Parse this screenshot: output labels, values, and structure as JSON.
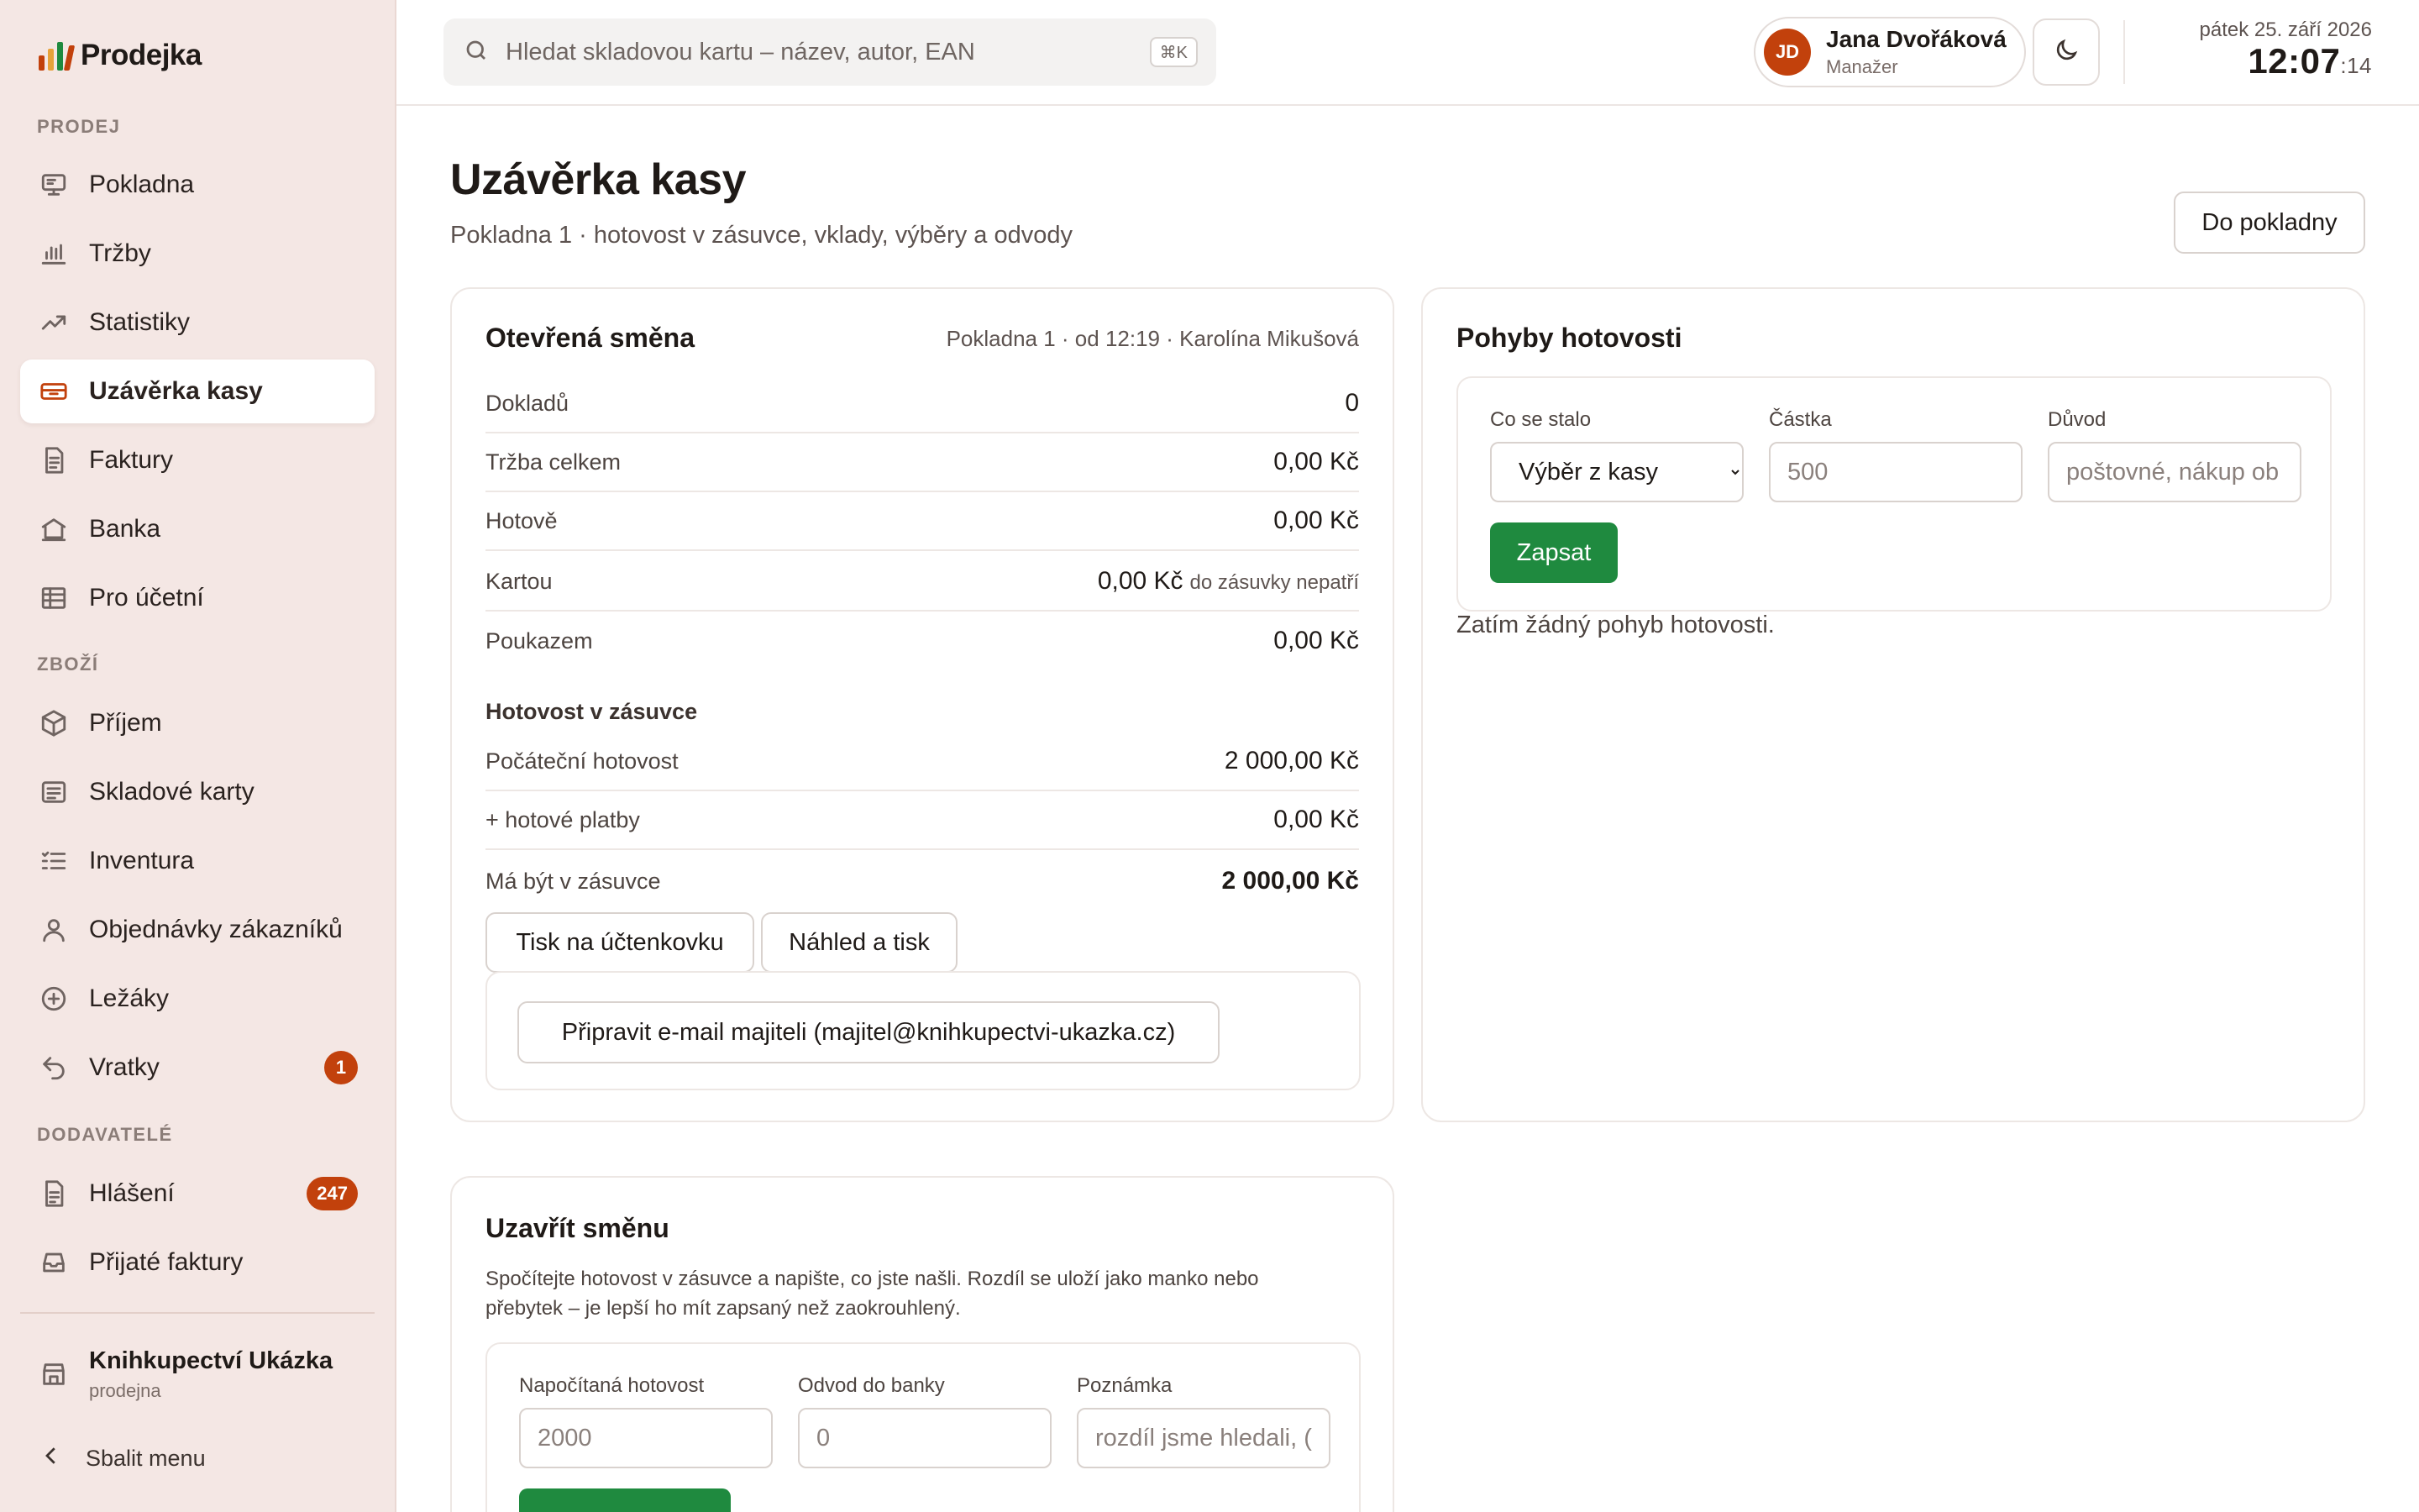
{
  "brand": {
    "name": "Prodejka",
    "logo_colors": [
      "#c2410c",
      "#e7a23a",
      "#1f8a3f",
      "#c2410c"
    ]
  },
  "sidebar": {
    "sections": {
      "prodej": "PRODEJ",
      "zbozi": "ZBOŽÍ",
      "dodavatele": "DODAVATELÉ"
    },
    "items": [
      {
        "label": "Pokladna",
        "icon": "register-icon"
      },
      {
        "label": "Tržby",
        "icon": "bar-chart-icon"
      },
      {
        "label": "Statistiky",
        "icon": "trend-icon"
      },
      {
        "label": "Uzávěrka kasy",
        "icon": "cash-drawer-icon",
        "active": true
      },
      {
        "label": "Faktury",
        "icon": "document-icon"
      },
      {
        "label": "Banka",
        "icon": "bank-icon"
      },
      {
        "label": "Pro účetní",
        "icon": "table-icon"
      },
      {
        "label": "Příjem",
        "icon": "box-icon"
      },
      {
        "label": "Skladové karty",
        "icon": "list-card-icon"
      },
      {
        "label": "Inventura",
        "icon": "checklist-icon"
      },
      {
        "label": "Objednávky zákazníků",
        "icon": "user-icon"
      },
      {
        "label": "Ležáky",
        "icon": "plus-circle-icon"
      },
      {
        "label": "Vratky",
        "icon": "return-icon",
        "badge": "1"
      },
      {
        "label": "Hlášení",
        "icon": "report-icon",
        "badge": "247"
      },
      {
        "label": "Přijaté faktury",
        "icon": "inbox-icon"
      }
    ],
    "store": {
      "name": "Knihkupectví Ukázka",
      "sub": "prodejna"
    },
    "collapse_label": "Sbalit menu"
  },
  "topbar": {
    "search_placeholder": "Hledat skladovou kartu – název, autor, EAN",
    "search_shortcut": "⌘K",
    "user": {
      "initials": "JD",
      "name": "Jana Dvořáková",
      "role": "Manažer"
    },
    "date": "pátek 25. září 2026",
    "time": "12:07",
    "seconds": ":14"
  },
  "page": {
    "title": "Uzávěrka kasy",
    "subtitle": "Pokladna 1 · hotovost v zásuvce, vklady, výběry a odvody",
    "back_button": "Do pokladny"
  },
  "shift": {
    "title": "Otevřená směna",
    "meta": "Pokladna 1 · od 12:19 · Karolína Mikušová",
    "rows": [
      {
        "label": "Dokladů",
        "value": "0"
      },
      {
        "label": "Tržba celkem",
        "value": "0,00 Kč"
      },
      {
        "label": "Hotově",
        "value": "0,00 Kč"
      },
      {
        "label": "Kartou",
        "value": "0,00 Kč",
        "note": "do zásuvky nepatří"
      },
      {
        "label": "Poukazem",
        "value": "0,00 Kč"
      }
    ],
    "cash_heading": "Hotovost v zásuvce",
    "cash_rows": [
      {
        "label": "Počáteční hotovost",
        "value": "2 000,00 Kč"
      },
      {
        "label": "+ hotové platby",
        "value": "0,00 Kč"
      },
      {
        "label": "Má být v zásuvce",
        "value": "2 000,00 Kč"
      }
    ],
    "btn_print_receipt": "Tisk na účtenkovku",
    "btn_preview": "Náhled a tisk",
    "btn_email": "Připravit e-mail majiteli (majitel@knihkupectvi-ukazka.cz)"
  },
  "movements": {
    "title": "Pohyby hotovosti",
    "label_what": "Co se stalo",
    "select_value": "Výběr z kasy",
    "label_amount": "Částka",
    "amount_placeholder": "500",
    "label_reason": "Důvod",
    "reason_placeholder": "poštovné, nákup ob",
    "btn_submit": "Zapsat",
    "empty": "Zatím žádný pohyb hotovosti."
  },
  "close_shift": {
    "title": "Uzavřít směnu",
    "description": "Spočítejte hotovost v zásuvce a napište, co jste našli. Rozdíl se uloží jako manko nebo přebytek – je lepší ho mít zapsaný než zaokrouhlený.",
    "label_counted": "Napočítaná hotovost",
    "counted_placeholder": "2000",
    "label_deposit": "Odvod do banky",
    "deposit_placeholder": "0",
    "label_note": "Poznámka",
    "note_placeholder": "rozdíl jsme hledali, ("
  }
}
